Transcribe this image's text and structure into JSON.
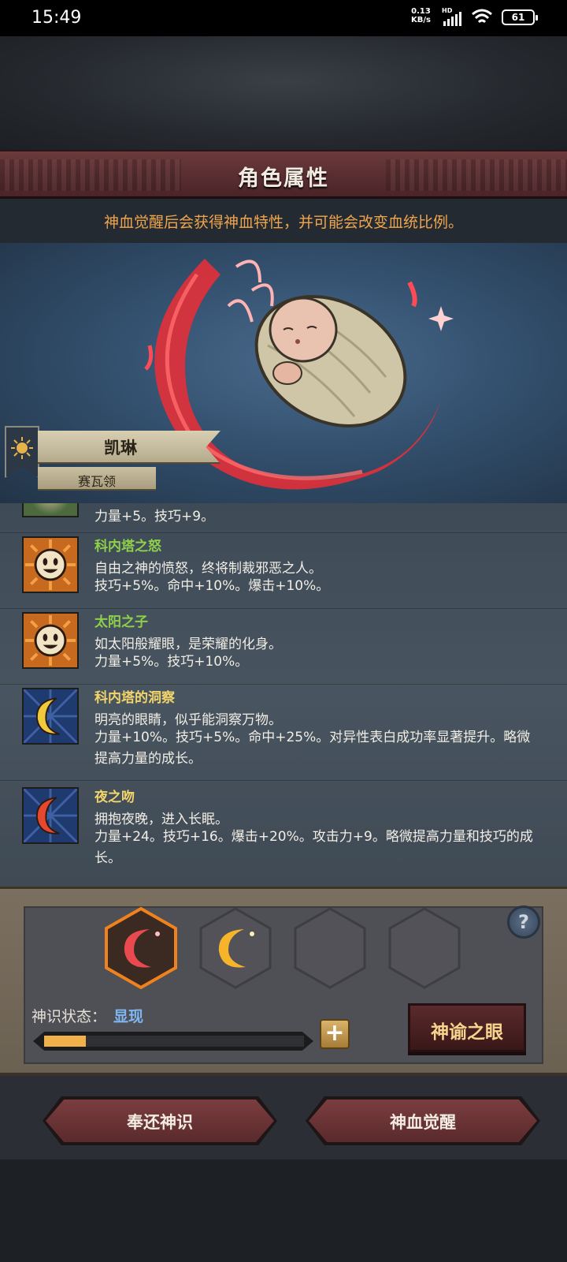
{
  "status_bar": {
    "time": "15:49",
    "net_speed_value": "0.13",
    "net_speed_unit": "KB/s",
    "hd_label": "HD",
    "battery": "61"
  },
  "header": {
    "title": "角色属性",
    "subtitle": "神血觉醒后会获得神血特性，并可能会改变血统比例。"
  },
  "character": {
    "name": "凯琳",
    "region": "赛瓦领"
  },
  "traits": [
    {
      "name": "",
      "desc": "",
      "stats": "力量+5。技巧+9。",
      "icon": "partial-green-icon"
    },
    {
      "name": "科内塔之怒",
      "name_color": "#8ed04a",
      "desc": "自由之神的愤怒，终将制裁邪恶之人。",
      "stats": "技巧+5%。命中+10%。爆击+10%。",
      "icon": "sun-face-icon"
    },
    {
      "name": "太阳之子",
      "name_color": "#8ed04a",
      "desc": "如太阳般耀眼，是荣耀的化身。",
      "stats": "力量+5%。技巧+10%。",
      "icon": "sun-face-icon"
    },
    {
      "name": "科内塔的洞察",
      "name_color": "#f2d56a",
      "desc": "明亮的眼睛，似乎能洞察万物。",
      "stats": "力量+10%。技巧+5%。命中+25%。对异性表白成功率显著提升。略微提高力量的成长。",
      "icon": "yellow-crescent-icon"
    },
    {
      "name": "夜之吻",
      "name_color": "#f2d56a",
      "desc": "拥抱夜晚，进入长眠。",
      "stats": "力量+24。技巧+16。爆击+20%。攻击力+9。略微提高力量和技巧的成长。",
      "icon": "red-crescent-icon"
    }
  ],
  "god_sense": {
    "slots": [
      "red-crescent",
      "gold-crescent",
      "empty",
      "empty"
    ],
    "status_label": "神识状态：",
    "status_value": "显现",
    "progress_fraction": 0.16,
    "oracle_button": "神谕之眼"
  },
  "actions": {
    "return_button": "奉还神识",
    "awaken_button": "神血觉醒"
  },
  "colors": {
    "header_red": "#5a2a2c",
    "subtitle_orange": "#f0a54c",
    "trait_green": "#8ed04a",
    "trait_yellow": "#f2d56a",
    "status_blue": "#7fb6ef",
    "progress_orange": "#f1b04a"
  }
}
